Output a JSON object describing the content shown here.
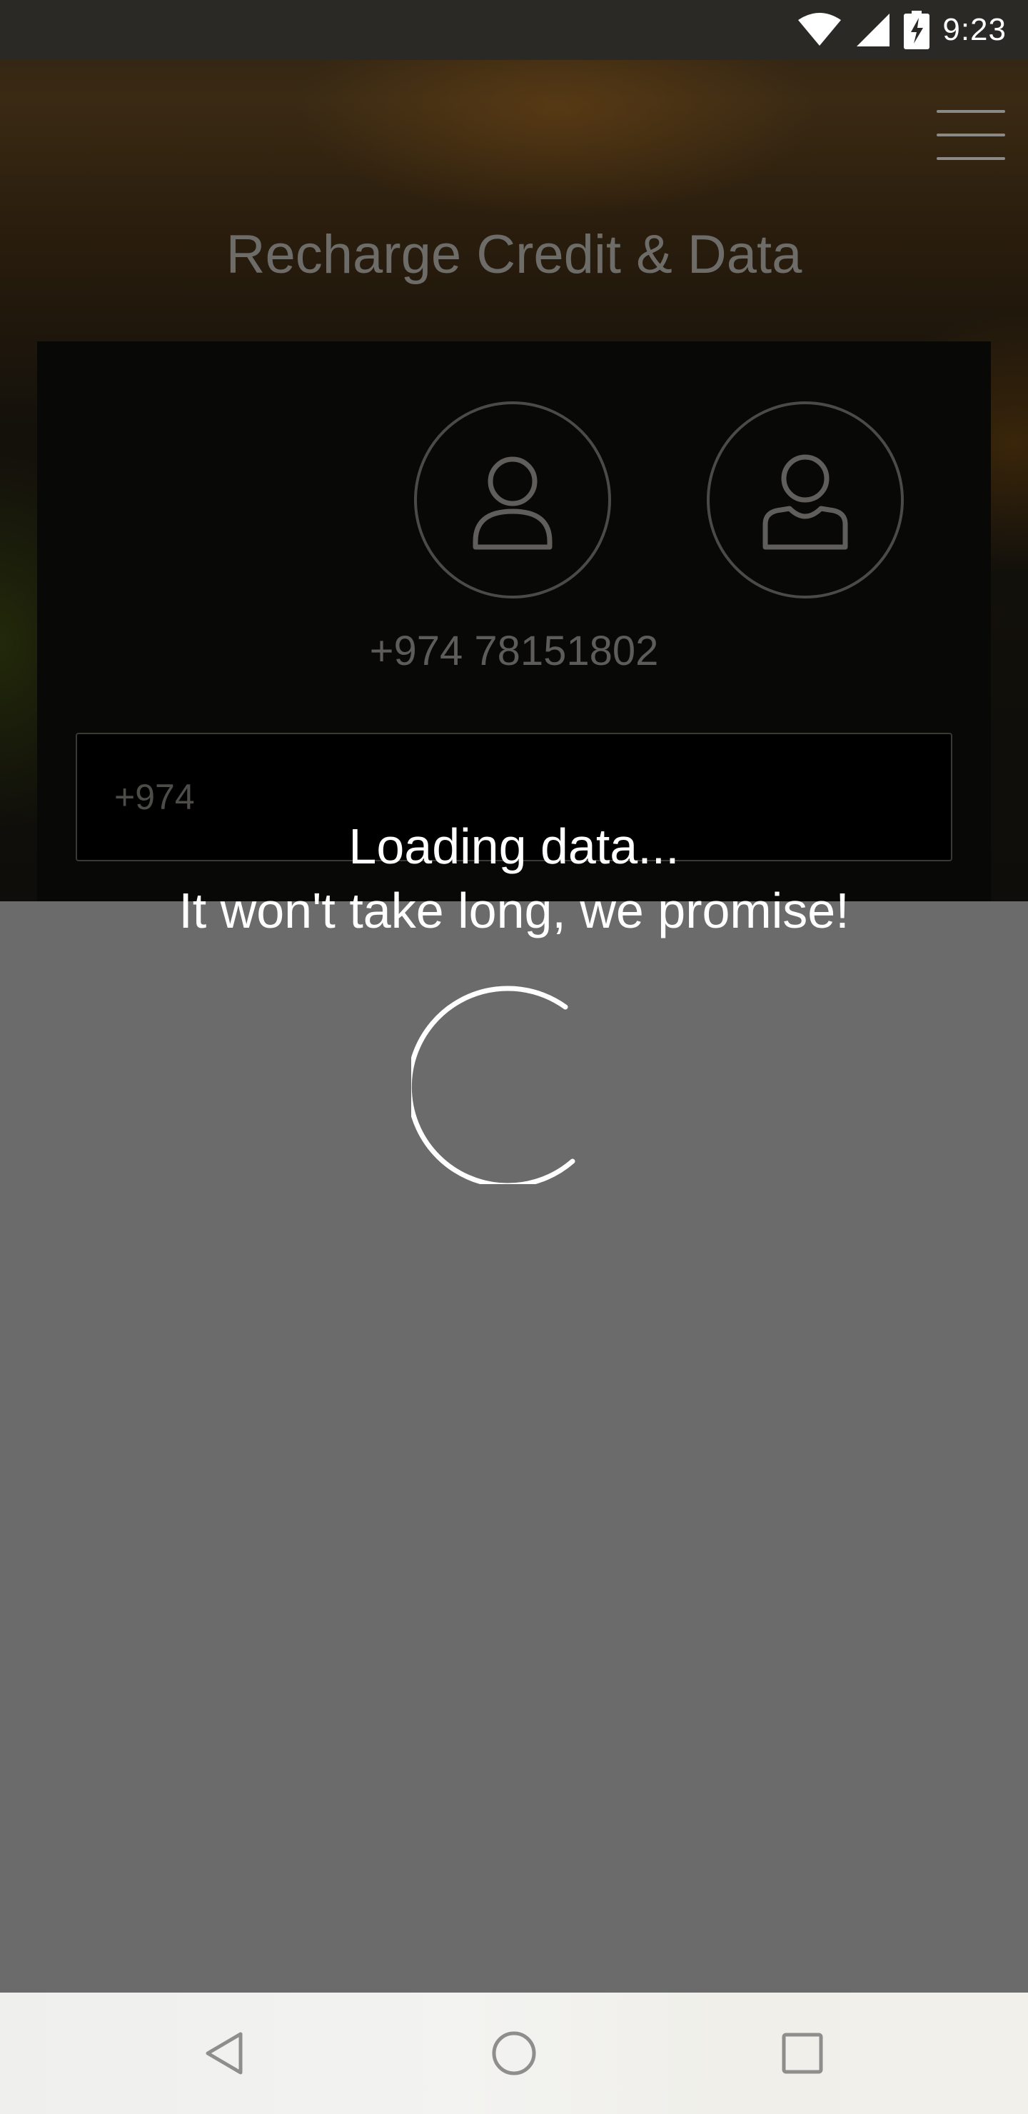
{
  "status_bar": {
    "time": "9:23",
    "icons": [
      "wifi-icon",
      "cellular-signal-icon",
      "battery-charging-icon"
    ]
  },
  "header": {
    "title": "Recharge Credit & Data",
    "menu_icon": "hamburger-menu-icon"
  },
  "recipient": {
    "avatars": [
      "person-icon",
      "contact-icon"
    ],
    "phone_number": "+974 78151802"
  },
  "phone_field": {
    "placeholder": "+974",
    "value": ""
  },
  "loading": {
    "line1": "Loading data...",
    "line2": "It won't take long, we promise!",
    "spinner_icon": "loading-spinner-icon"
  },
  "nav_bar": {
    "buttons": [
      "back-icon",
      "home-icon",
      "recent-apps-icon"
    ]
  },
  "colors": {
    "overlay": "#6b6b6b",
    "title_text": "#6d6c69",
    "loading_text": "#ffffff",
    "nav_background": "#f1f1ef"
  }
}
